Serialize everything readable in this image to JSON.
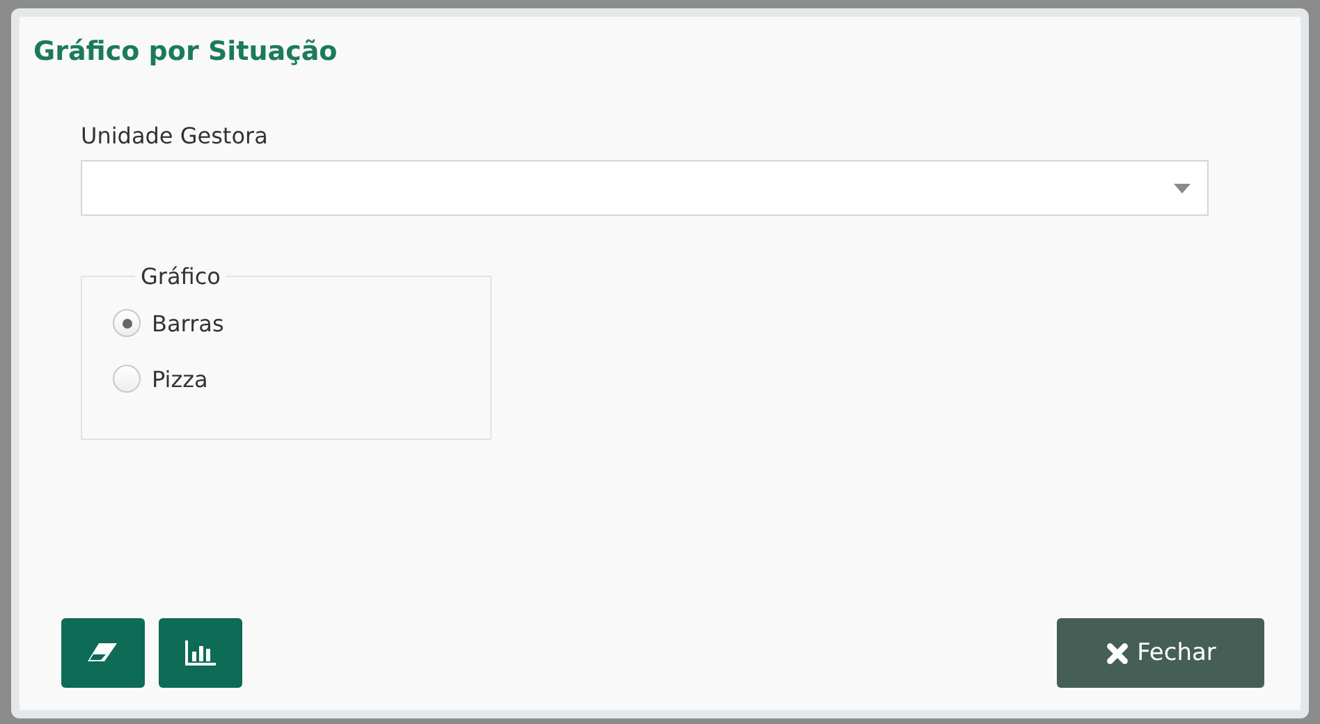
{
  "dialog": {
    "title": "Gráfico por Situação"
  },
  "unidade_gestora": {
    "label": "Unidade Gestora"
  },
  "grafico": {
    "legend": "Gráfico",
    "options": [
      {
        "label": "Barras",
        "selected": true
      },
      {
        "label": "Pizza",
        "selected": false
      }
    ]
  },
  "buttons": {
    "close": "Fechar"
  }
}
